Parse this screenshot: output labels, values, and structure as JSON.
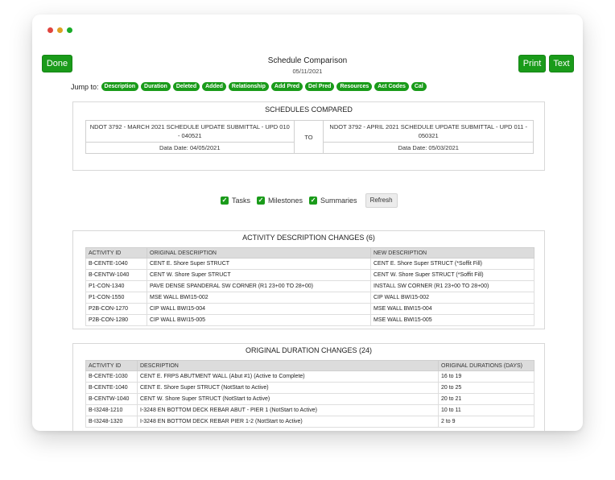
{
  "header": {
    "done_label": "Done",
    "title": "Schedule Comparison",
    "date": "05/11/2021",
    "print_label": "Print",
    "text_label": "Text"
  },
  "jump": {
    "label": "Jump to:",
    "links": [
      "Description",
      "Duration",
      "Deleted",
      "Added",
      "Relationship",
      "Add Pred",
      "Del Pred",
      "Resources",
      "Act Codes",
      "Cal"
    ]
  },
  "schedules": {
    "title": "SCHEDULES COMPARED",
    "left_name": "NDOT 3792 - MARCH 2021 SCHEDULE UPDATE SUBMITTAL - UPD 010 - 040521",
    "to_label": "TO",
    "right_name": "NDOT 3792 - APRIL 2021 SCHEDULE UPDATE SUBMITTAL - UPD 011 - 050321",
    "left_date": "Data Date: 04/05/2021",
    "right_date": "Data Date: 05/03/2021"
  },
  "filters": {
    "tasks": "Tasks",
    "milestones": "Milestones",
    "summaries": "Summaries",
    "refresh_label": "Refresh"
  },
  "description_changes": {
    "title": "ACTIVITY DESCRIPTION CHANGES (6)",
    "headers": [
      "ACTIVITY ID",
      "ORIGINAL DESCRIPTION",
      "NEW DESCRIPTION"
    ],
    "rows": [
      [
        "B-CENTE-1040",
        "CENT E. Shore Super STRUCT",
        "CENT E. Shore Super STRUCT (*Soffit Fill)"
      ],
      [
        "B-CENTW-1040",
        "CENT W. Shore Super STRUCT",
        "CENT W. Shore Super STRUCT (*Soffit Fill)"
      ],
      [
        "P1-CON-1340",
        "PAVE DENSE SPANDERAL SW CORNER (R1 23+00 TO 28+00)",
        "INSTALL SW CORNER (R1 23+00 TO 28+00)"
      ],
      [
        "P1-CON-1550",
        "MSE WALL BWI15-002",
        "CIP WALL BWI15-002"
      ],
      [
        "P2B-CON-1270",
        "CIP WALL BWI15-004",
        "MSE WALL BWI15-004"
      ],
      [
        "P2B-CON-1280",
        "CIP WALL BWI15-005",
        "MSE WALL BWI15-005"
      ]
    ]
  },
  "duration_changes": {
    "title": "ORIGINAL DURATION CHANGES (24)",
    "headers": [
      "ACTIVITY ID",
      "DESCRIPTION",
      "ORIGINAL DURATIONS (DAYS)"
    ],
    "rows": [
      [
        "B-CENTE-1030",
        "CENT E. FRPS ABUTMENT WALL (Abut #1) (Active to Complete)",
        "16 to 19"
      ],
      [
        "B-CENTE-1040",
        "CENT E. Shore Super STRUCT (NotStart to Active)",
        "20 to 25"
      ],
      [
        "B-CENTW-1040",
        "CENT W. Shore Super STRUCT (NotStart to Active)",
        "20 to 21"
      ],
      [
        "B-I3248-1210",
        "I-3248 EN BOTTOM DECK REBAR ABUT - PIER 1 (NotStart to Active)",
        "10 to 11"
      ],
      [
        "B-I3248-1320",
        "I-3248 EN BOTTOM DECK REBAR PIER 1-2 (NotStart to Active)",
        "2 to 9"
      ]
    ]
  }
}
